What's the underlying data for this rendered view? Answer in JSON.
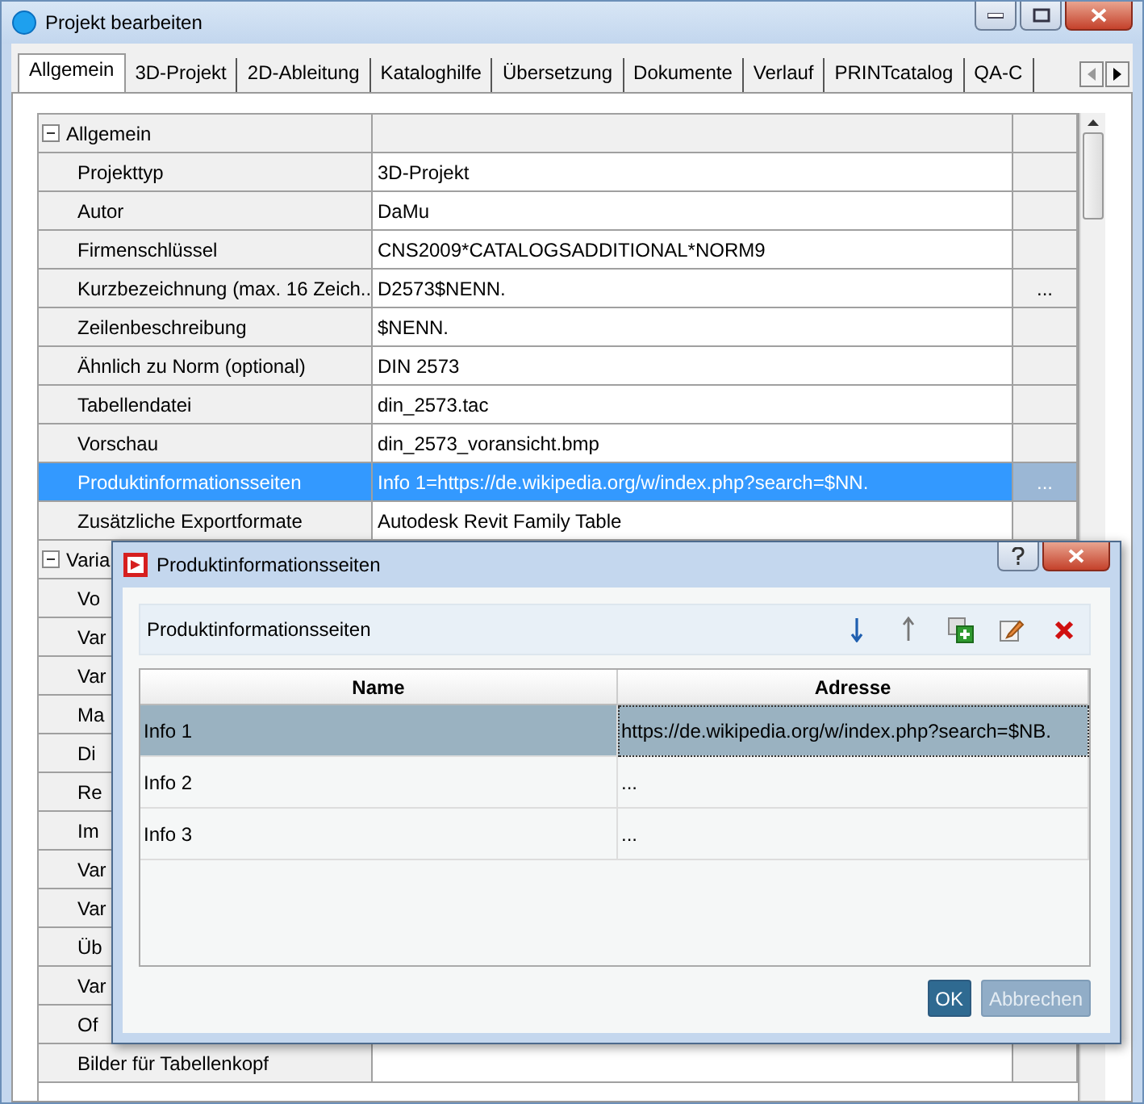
{
  "window": {
    "title": "Projekt bearbeiten"
  },
  "tabs": [
    {
      "label": "Allgemein",
      "selected": true
    },
    {
      "label": "3D-Projekt",
      "selected": false
    },
    {
      "label": "2D-Ableitung",
      "selected": false
    },
    {
      "label": "Kataloghilfe",
      "selected": false
    },
    {
      "label": "Übersetzung",
      "selected": false
    },
    {
      "label": "Dokumente",
      "selected": false
    },
    {
      "label": "Verlauf",
      "selected": false
    },
    {
      "label": "PRINTcatalog",
      "selected": false
    },
    {
      "label": "QA-C",
      "selected": false
    }
  ],
  "grid": {
    "groups": [
      {
        "title": "Allgemein",
        "expanded": true,
        "rows": [
          {
            "name": "Projekttyp",
            "value": "3D-Projekt",
            "selected": false
          },
          {
            "name": "Autor",
            "value": "DaMu",
            "selected": false
          },
          {
            "name": "Firmenschlüssel",
            "value": "CNS2009*CATALOGSADDITIONAL*NORM9",
            "selected": false
          },
          {
            "name": "Kurzbezeichnung (max. 16 Zeich...",
            "value": "D2573$NENN.",
            "button": "...",
            "selected": false
          },
          {
            "name": "Zeilenbeschreibung",
            "value": "$NENN.",
            "selected": false
          },
          {
            "name": "Ähnlich zu Norm (optional)",
            "value": "DIN 2573",
            "selected": false
          },
          {
            "name": "Tabellendatei",
            "value": "din_2573.tac",
            "selected": false
          },
          {
            "name": "Vorschau",
            "value": "din_2573_voransicht.bmp",
            "selected": false
          },
          {
            "name": "Produktinformationsseiten",
            "value": "Info 1=https://de.wikipedia.org/w/index.php?search=$NN.",
            "button": "...",
            "selected": true
          },
          {
            "name": "Zusätzliche Exportformate",
            "value": "Autodesk Revit Family Table",
            "selected": false
          }
        ]
      },
      {
        "title": "Varia",
        "expanded": true,
        "rows": [
          {
            "name": "Vo",
            "selected": false
          },
          {
            "name": "Var",
            "selected": false
          },
          {
            "name": "Var",
            "selected": false
          },
          {
            "name": "Ma",
            "selected": false
          },
          {
            "name": "Di",
            "selected": false
          },
          {
            "name": "Re",
            "selected": false
          },
          {
            "name": "Im",
            "selected": false
          },
          {
            "name": "Var",
            "selected": false
          },
          {
            "name": "Var",
            "selected": false
          },
          {
            "name": "Üb",
            "selected": false
          },
          {
            "name": "Var",
            "selected": false
          },
          {
            "name": "Of",
            "selected": false
          },
          {
            "name": "Bilder für Tabellenkopf",
            "selected": false
          }
        ]
      }
    ]
  },
  "dialog": {
    "title": "Produktinformationsseiten",
    "toolbar_label": "Produktinformationsseiten",
    "columns": [
      "Name",
      "Adresse"
    ],
    "rows": [
      {
        "name": "Info 1",
        "address": "https://de.wikipedia.org/w/index.php?search=$NB.",
        "selected": true
      },
      {
        "name": "Info 2",
        "address": "...",
        "selected": false
      },
      {
        "name": "Info 3",
        "address": "...",
        "selected": false
      }
    ],
    "buttons": [
      {
        "label": "OK",
        "kind": "primary"
      },
      {
        "label": "Abbrechen",
        "kind": "disabled"
      }
    ]
  }
}
